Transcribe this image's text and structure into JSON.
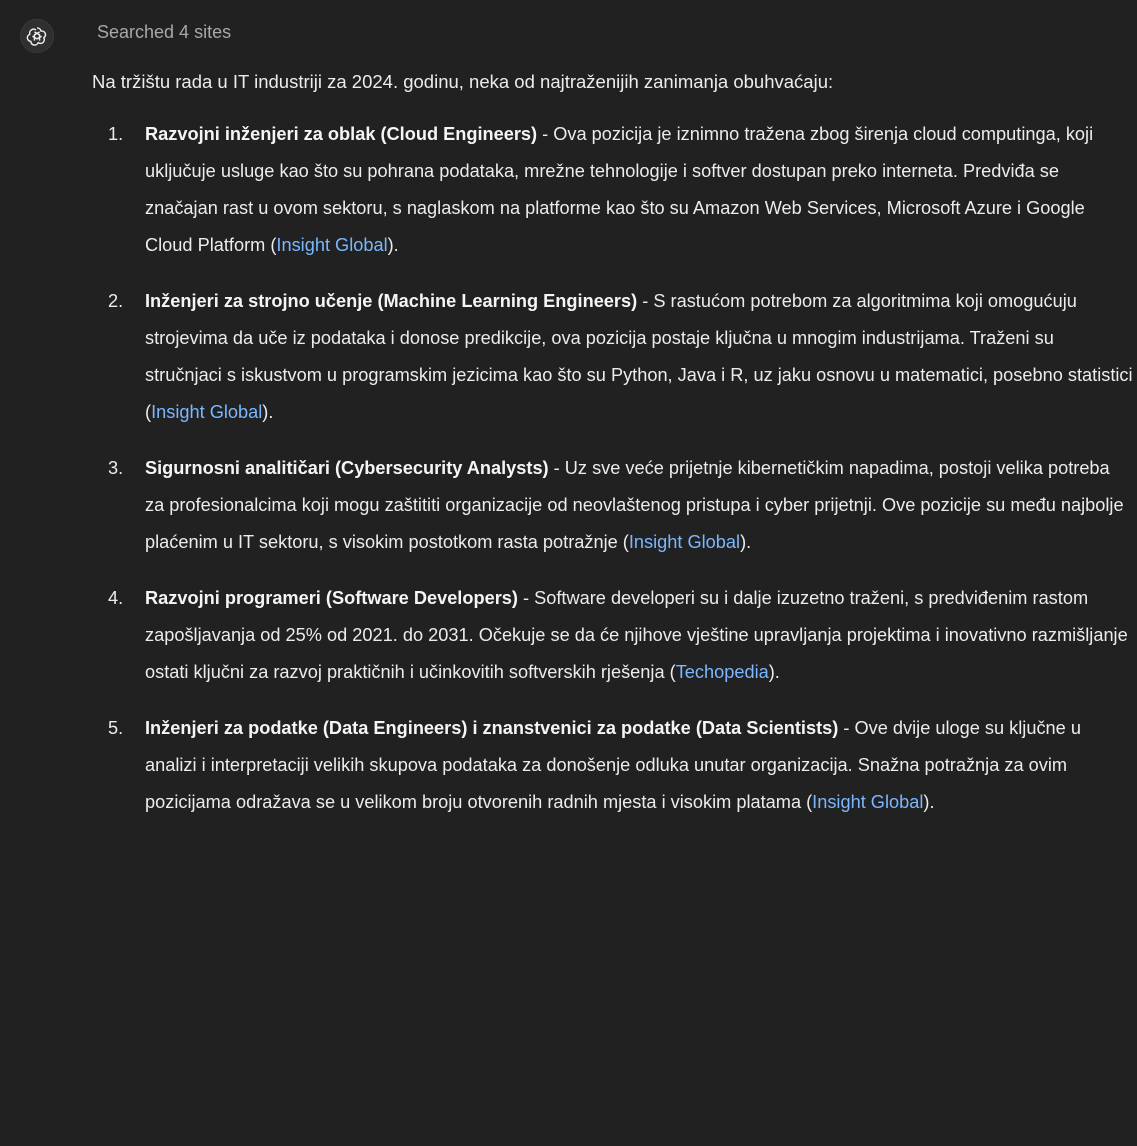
{
  "assistant": {
    "avatar_icon": "openai-logo-icon"
  },
  "searched_label": "Searched 4 sites",
  "intro": "Na tržištu rada u IT industriji za 2024. godinu, neka od najtraženijih zanimanja obuhvaćaju:",
  "items": [
    {
      "number": "1.",
      "title": "Razvojni inženjeri za oblak (Cloud Engineers)",
      "text": " - Ova pozicija je iznimno tražena zbog širenja cloud computinga, koji uključuje usluge kao što su pohrana podataka, mrežne tehnologije i softver dostupan preko interneta. Predviđa se značajan rast u ovom sektoru, s naglaskom na platforme kao što su Amazon Web Services, Microsoft Azure i Google Cloud Platform (",
      "link": "Insight Global",
      "tail": ")."
    },
    {
      "number": "2.",
      "title": "Inženjeri za strojno učenje (Machine Learning Engineers)",
      "text": " - S rastućom potrebom za algoritmima koji omogućuju strojevima da uče iz podataka i donose predikcije, ova pozicija postaje ključna u mnogim industrijama. Traženi su stručnjaci s iskustvom u programskim jezicima kao što su Python, Java i R, uz jaku osnovu u matematici, posebno statistici (",
      "link": "Insight Global",
      "tail": ")."
    },
    {
      "number": "3.",
      "title": "Sigurnosni analitičari (Cybersecurity Analysts)",
      "text": " - Uz sve veće prijetnje kibernetičkim napadima, postoji velika potreba za profesionalcima koji mogu zaštititi organizacije od neovlaštenog pristupa i cyber prijetnji. Ove pozicije su među najbolje plaćenim u IT sektoru, s visokim postotkom rasta potražnje (",
      "link": "Insight Global",
      "tail": ")."
    },
    {
      "number": "4.",
      "title": "Razvojni programeri (Software Developers)",
      "text": " - Software developeri su i dalje izuzetno traženi, s predviđenim rastom zapošljavanja od 25% od 2021. do 2031. Očekuje se da će njihove vještine upravljanja projektima i inovativno razmišljanje ostati ključni za razvoj praktičnih i učinkovitih softverskih rješenja (",
      "link": "Techopedia",
      "tail": ")."
    },
    {
      "number": "5.",
      "title": "Inženjeri za podatke (Data Engineers) i znanstvenici za podatke (Data Scientists)",
      "text": " - Ove dvije uloge su ključne u analizi i interpretaciji velikih skupova podataka za donošenje odluka unutar organizacija. Snažna potražnja za ovim pozicijama odražava se u velikom broju otvorenih radnih mjesta i visokim platama (",
      "link": "Insight Global",
      "tail": ")."
    }
  ],
  "colors": {
    "background": "#212121",
    "text": "#ececec",
    "muted": "#a8a8a8",
    "link": "#7ab7ff"
  }
}
